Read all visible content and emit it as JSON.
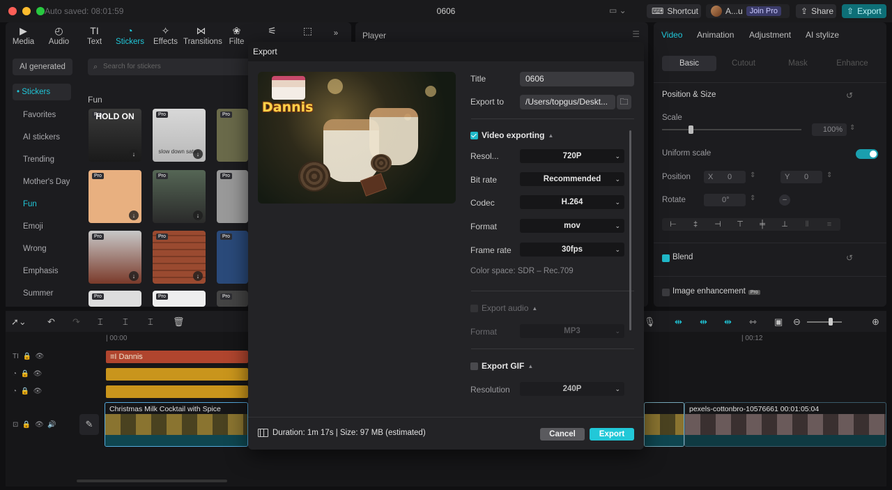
{
  "window": {
    "autosave": "Auto saved: 08:01:59",
    "title": "0606",
    "shortcut_label": "Shortcut",
    "user_name": "A...u",
    "join_pro": "Join Pro",
    "share_label": "Share",
    "export_label": "Export"
  },
  "toolbar": {
    "items": [
      {
        "label": "Media",
        "icon": "▶"
      },
      {
        "label": "Audio",
        "icon": "◴"
      },
      {
        "label": "Text",
        "icon": "TI"
      },
      {
        "label": "Stickers",
        "icon": "◔"
      },
      {
        "label": "Effects",
        "icon": "✧"
      },
      {
        "label": "Transitions",
        "icon": "⋈"
      },
      {
        "label": "Filte",
        "icon": "❀"
      },
      {
        "label": "",
        "icon": "⚟"
      },
      {
        "label": "",
        "icon": "⬚"
      }
    ],
    "more": "»"
  },
  "sidebar": {
    "ai_generated": "AI generated",
    "stickers": "• Stickers",
    "items": [
      "Favorites",
      "AI stickers",
      "Trending",
      "Mother's Day",
      "Fun",
      "Emoji",
      "Wrong",
      "Emphasis",
      "Summer"
    ]
  },
  "stickers_panel": {
    "search_placeholder": "Search for stickers",
    "section_title": "Fun",
    "pro_badge": "Pro",
    "thumb_captions": [
      "HOLD ON",
      "slow down satan"
    ]
  },
  "player": {
    "title": "Player"
  },
  "right_panel": {
    "tabs": [
      "Video",
      "Animation",
      "Adjustment",
      "AI stylize"
    ],
    "subtabs": [
      "Basic",
      "Cutout",
      "Mask",
      "Enhance"
    ],
    "position_size": "Position & Size",
    "scale_label": "Scale",
    "scale_value": "100%",
    "uniform_scale": "Uniform scale",
    "position_label": "Position",
    "pos_x_label": "X",
    "pos_x": "0",
    "pos_y_label": "Y",
    "pos_y": "0",
    "rotate_label": "Rotate",
    "rotate_value": "0°",
    "blend": "Blend",
    "image_enhancement": "Image enhancement",
    "pro_badge": "Pro"
  },
  "timeline": {
    "ruler_start": "| 00:00",
    "ruler_end": "| 00:12",
    "text_track": "Dannis",
    "video_clip_1": "Christmas Milk Cocktail with Spice Eggnog",
    "video_clip_2": "pexels-cottonbro-10576661  00:01:05:04"
  },
  "export_dialog": {
    "title": "Export",
    "preview_overlay_text": "Dannis",
    "title_label": "Title",
    "title_value": "0606",
    "export_to_label": "Export to",
    "export_to_value": "/Users/topgus/Deskt...",
    "video_exporting": "Video exporting",
    "resolution_label": "Resol...",
    "resolution_value": "720P",
    "bitrate_label": "Bit rate",
    "bitrate_value": "Recommended",
    "codec_label": "Codec",
    "codec_value": "H.264",
    "format_label": "Format",
    "format_value": "mov",
    "framerate_label": "Frame rate",
    "framerate_value": "30fps",
    "color_space": "Color space: SDR – Rec.709",
    "export_audio": "Export audio",
    "audio_format_label": "Format",
    "audio_format_value": "MP3",
    "export_gif": "Export GIF",
    "gif_resolution_label": "Resolution",
    "gif_resolution_value": "240P",
    "duration_info": "Duration: 1m 17s | Size: 97 MB (estimated)",
    "cancel_label": "Cancel",
    "export_label": "Export"
  },
  "colors": {
    "accent": "#20c6d8",
    "export_button": "#22c8d8",
    "text_track": "#b0452e",
    "sticker_track": "#c9951c"
  }
}
